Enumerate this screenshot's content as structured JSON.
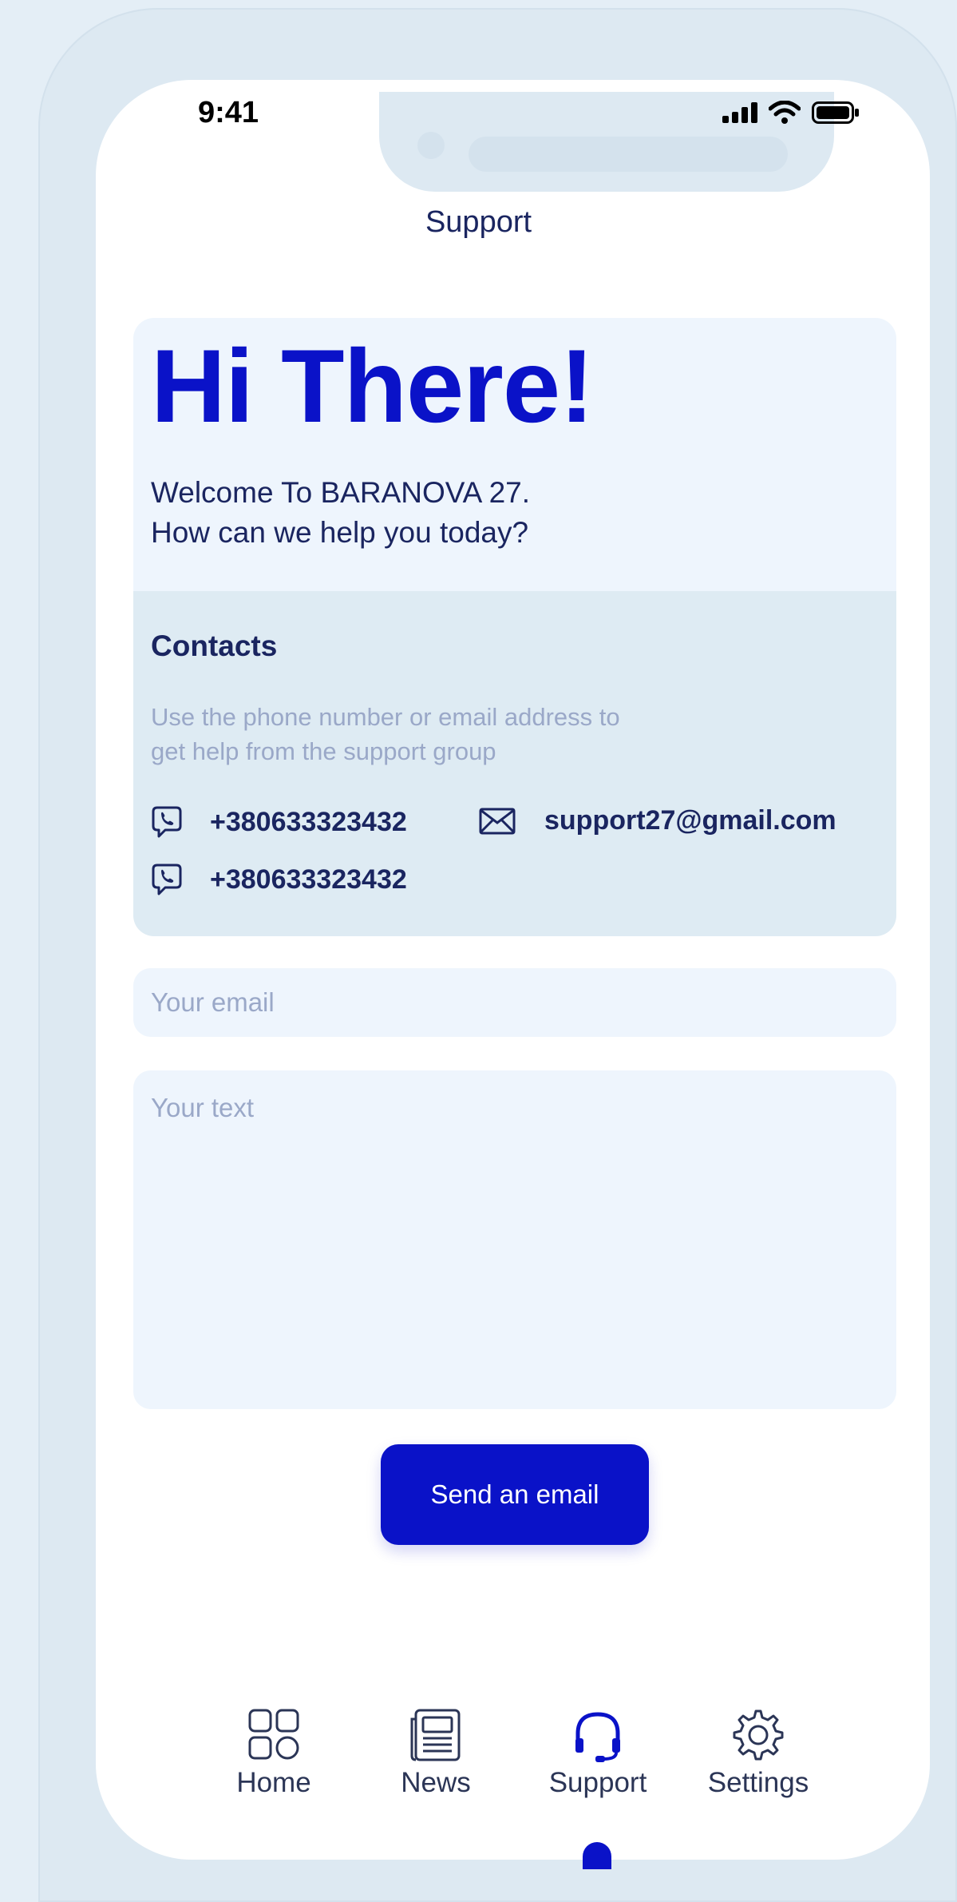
{
  "status_bar": {
    "time": "9:41"
  },
  "header": {
    "title": "Support"
  },
  "hero": {
    "title": "Hi There!",
    "subtitle_line1": "Welcome To BARANOVA 27.",
    "subtitle_line2": "How can we help you today?"
  },
  "contacts": {
    "heading": "Contacts",
    "description_line1": "Use the phone number or email address to",
    "description_line2": "get help from the support group",
    "phone1": "+380633323432",
    "phone2": "+380633323432",
    "email": "support27@gmail.com"
  },
  "form": {
    "email_placeholder": "Your email",
    "text_placeholder": "Your text",
    "send_label": "Send an email"
  },
  "tabbar": {
    "items": [
      {
        "label": "Home",
        "icon": "home-grid-icon"
      },
      {
        "label": "News",
        "icon": "news-icon"
      },
      {
        "label": "Support",
        "icon": "headset-icon",
        "active": true
      },
      {
        "label": "Settings",
        "icon": "gear-icon"
      }
    ]
  },
  "colors": {
    "accent": "#0a12c8",
    "text_dark": "#1a2560",
    "muted": "#9aa8c8",
    "card_light": "#eef5fd",
    "card_contacts": "#deebf3"
  }
}
